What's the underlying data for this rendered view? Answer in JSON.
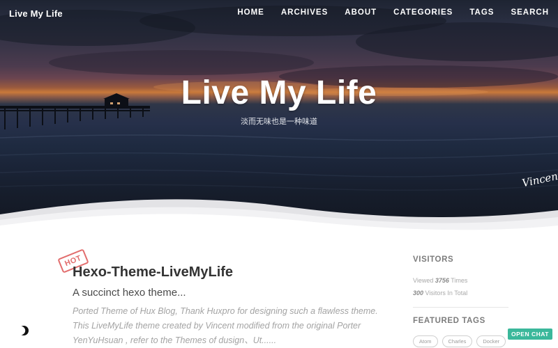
{
  "header": {
    "brand": "Live My Life",
    "nav": [
      "HOME",
      "ARCHIVES",
      "ABOUT",
      "CATEGORIES",
      "TAGS",
      "SEARCH"
    ]
  },
  "hero": {
    "title": "Live My Life",
    "subtitle": "淡而无味也是一种味道",
    "signature": "Vincent."
  },
  "post": {
    "badge": "HOT",
    "title": "Hexo-Theme-LiveMyLife",
    "subtitle": "A succinct hexo theme...",
    "excerpt": "Ported Theme of Hux Blog, Thank Huxpro for designing such a flawless theme. This LiveMyLife theme created by Vincent modified from the original Porter YenYuHsuan , refer to the Themes of dusign、Ut......"
  },
  "sidebar": {
    "visitors_heading": "VISITORS",
    "views_prefix": "Viewed",
    "views_count": "3756",
    "views_suffix": "Times",
    "visitors_count": "300",
    "visitors_suffix": "Visitors In Total",
    "featured_tags_heading": "FEATURED TAGS",
    "tags": [
      "Atom",
      "Charles",
      "Docker"
    ]
  },
  "floating": {
    "chat_label": "OPEN CHAT",
    "theme_toggle_icon": "moon-icon"
  },
  "colors": {
    "chat_button": "#3bb89b",
    "hot_badge": "#e26d6d"
  }
}
